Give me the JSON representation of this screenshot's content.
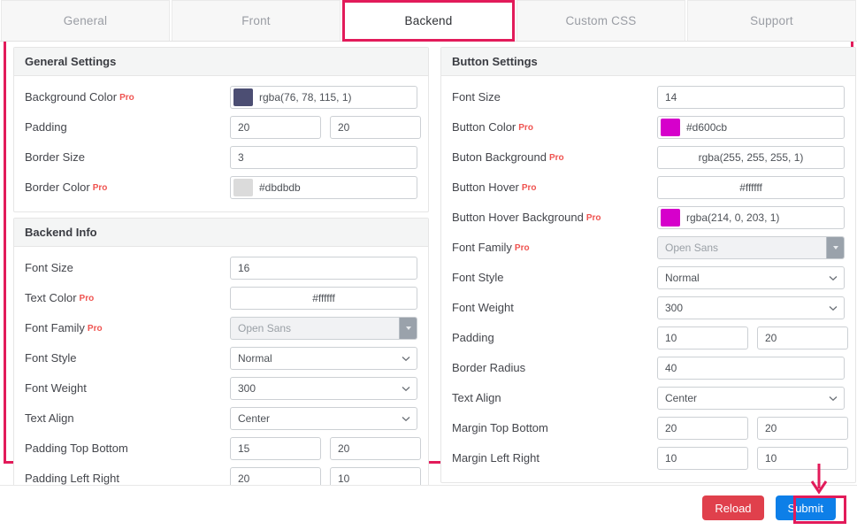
{
  "tabs": [
    {
      "label": "General",
      "active": false
    },
    {
      "label": "Front",
      "active": false
    },
    {
      "label": "Backend",
      "active": true
    },
    {
      "label": "Custom CSS",
      "active": false
    },
    {
      "label": "Support",
      "active": false
    }
  ],
  "left": {
    "general_settings": {
      "title": "General Settings",
      "rows": {
        "background_color": {
          "label": "Background Color",
          "pro": "Pro",
          "value": "rgba(76, 78, 115, 1)",
          "swatch": "#4c4e73"
        },
        "padding": {
          "label": "Padding",
          "value1": "20",
          "value2": "20"
        },
        "border_size": {
          "label": "Border Size",
          "value": "3"
        },
        "border_color": {
          "label": "Border Color",
          "pro": "Pro",
          "value": "#dbdbdb",
          "swatch": "#dbdbdb"
        }
      }
    },
    "backend_info": {
      "title": "Backend Info",
      "rows": {
        "font_size": {
          "label": "Font Size",
          "value": "16"
        },
        "text_color": {
          "label": "Text Color",
          "pro": "Pro",
          "value": "#ffffff",
          "swatch": "#ffffff"
        },
        "font_family": {
          "label": "Font Family",
          "pro": "Pro",
          "value": "Open Sans"
        },
        "font_style": {
          "label": "Font Style",
          "value": "Normal"
        },
        "font_weight": {
          "label": "Font Weight",
          "value": "300"
        },
        "text_align": {
          "label": "Text Align",
          "value": "Center"
        },
        "padding_top_bottom": {
          "label": "Padding Top Bottom",
          "value1": "15",
          "value2": "20"
        },
        "padding_left_right": {
          "label": "Padding Left Right",
          "value1": "20",
          "value2": "10"
        }
      }
    }
  },
  "right": {
    "button_settings": {
      "title": "Button Settings",
      "rows": {
        "font_size": {
          "label": "Font Size",
          "value": "14"
        },
        "button_color": {
          "label": "Button Color",
          "pro": "Pro",
          "value": "#d600cb",
          "swatch": "#d600cb"
        },
        "button_background": {
          "label": "Buton Background",
          "pro": "Pro",
          "value": "rgba(255, 255, 255, 1)",
          "swatch": "#ffffff"
        },
        "button_hover": {
          "label": "Button Hover",
          "pro": "Pro",
          "value": "#ffffff",
          "swatch": "#ffffff"
        },
        "button_hover_background": {
          "label": "Button Hover Background",
          "pro": "Pro",
          "value": "rgba(214, 0, 203, 1)",
          "swatch": "#d600cb"
        },
        "font_family": {
          "label": "Font Family",
          "pro": "Pro",
          "value": "Open Sans"
        },
        "font_style": {
          "label": "Font Style",
          "value": "Normal"
        },
        "font_weight": {
          "label": "Font Weight",
          "value": "300"
        },
        "padding": {
          "label": "Padding",
          "value1": "10",
          "value2": "20"
        },
        "border_radius": {
          "label": "Border Radius",
          "value": "40"
        },
        "text_align": {
          "label": "Text Align",
          "value": "Center"
        },
        "margin_top_bottom": {
          "label": "Margin Top Bottom",
          "value1": "20",
          "value2": "20"
        },
        "margin_left_right": {
          "label": "Margin Left Right",
          "value1": "10",
          "value2": "10"
        }
      }
    }
  },
  "footer": {
    "reload_label": "Reload",
    "submit_label": "Submit"
  },
  "colors": {
    "highlight": "#e21b5a",
    "submit": "#0d7fe8",
    "reload": "#e0404c",
    "pro": "#ef5350"
  }
}
